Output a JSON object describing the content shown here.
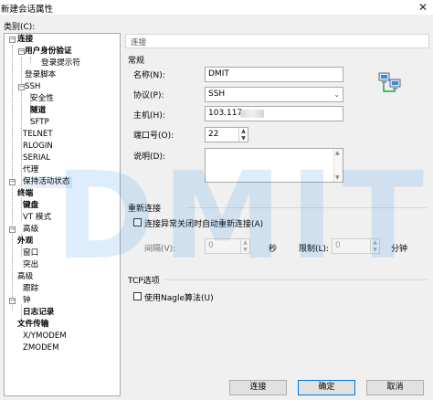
{
  "window": {
    "title": "新建会话属性",
    "close": "✕"
  },
  "category_label": "类别(C):",
  "tree": [
    {
      "label": "连接",
      "bold": true
    },
    {
      "label": "用户身份验证",
      "bold": true
    },
    {
      "label": "登录提示符",
      "bold": false
    },
    {
      "label": "登录脚本",
      "bold": false
    },
    {
      "label": "SSH",
      "bold": false
    },
    {
      "label": "安全性",
      "bold": false
    },
    {
      "label": "隧道",
      "bold": true
    },
    {
      "label": "SFTP",
      "bold": false
    },
    {
      "label": "TELNET",
      "bold": false
    },
    {
      "label": "RLOGIN",
      "bold": false
    },
    {
      "label": "SERIAL",
      "bold": false
    },
    {
      "label": "代理",
      "bold": false
    },
    {
      "label": "保持活动状态",
      "bold": false
    },
    {
      "label": "终端",
      "bold": true
    },
    {
      "label": "键盘",
      "bold": true
    },
    {
      "label": "VT 模式",
      "bold": false
    },
    {
      "label": "高级",
      "bold": false
    },
    {
      "label": "外观",
      "bold": true
    },
    {
      "label": "窗口",
      "bold": false
    },
    {
      "label": "突出",
      "bold": false
    },
    {
      "label": "高级",
      "bold": false
    },
    {
      "label": "跟踪",
      "bold": false
    },
    {
      "label": "钟",
      "bold": false
    },
    {
      "label": "日志记录",
      "bold": true
    },
    {
      "label": "文件传输",
      "bold": true
    },
    {
      "label": "X/YMODEM",
      "bold": false
    },
    {
      "label": "ZMODEM",
      "bold": false
    }
  ],
  "breadcrumb": "连接",
  "general": {
    "section": "常规",
    "name_label": "名称(N):",
    "name_value": "DMIT",
    "protocol_label": "协议(P):",
    "protocol_value": "SSH",
    "host_label": "主机(H):",
    "host_value": "103.117.",
    "port_label": "端口号(O):",
    "port_value": "22",
    "desc_label": "说明(D):",
    "desc_value": ""
  },
  "reconnect": {
    "section": "重新连接",
    "checkbox_label": "连接异常关闭时自动重新连接(A)",
    "interval_label": "间隔(V):",
    "interval_value": "0",
    "interval_unit": "秒",
    "limit_label": "限制(L):",
    "limit_value": "0",
    "limit_unit": "分钟"
  },
  "tcp": {
    "section": "TCP选项",
    "nagle_label": "使用Nagle算法(U)"
  },
  "buttons": {
    "connect": "连接",
    "ok": "确定",
    "cancel": "取消"
  },
  "watermark": "DMIT",
  "colors": {
    "selection": "#e5f0fb",
    "watermark": "#1e88e5",
    "default_button_border": "#0078d7"
  }
}
